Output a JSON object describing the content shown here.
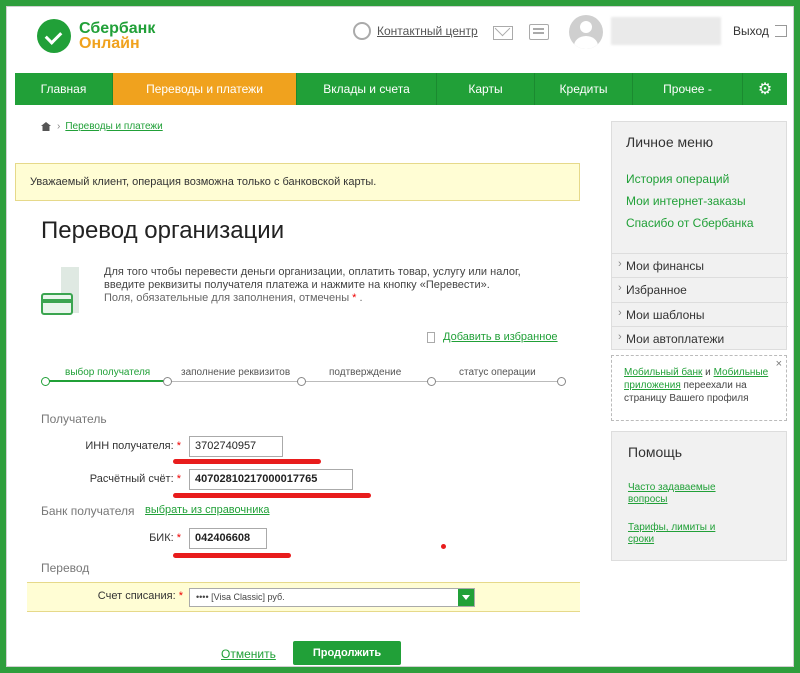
{
  "header": {
    "logo_line1": "Сбербанк",
    "logo_line2": "Онлайн",
    "contact": "Контактный центр",
    "logout": "Выход"
  },
  "nav": {
    "items": [
      "Главная",
      "Переводы и платежи",
      "Вклады и счета",
      "Карты",
      "Кредиты",
      "Прочее -"
    ],
    "active_index": 1,
    "settings_icon": "⚙"
  },
  "breadcrumb": {
    "current": "Переводы и платежи"
  },
  "alert": "Уважаемый клиент, операция возможна только с банковской карты.",
  "page": {
    "title": "Перевод организации",
    "intro": "Для того чтобы перевести деньги организации, оплатить товар, услугу или налог, введите реквизиты получателя платежа и нажмите на кнопку «Перевести».",
    "required_note": "Поля, обязательные для заполнения, отмечены",
    "required_star": "*",
    "required_tail": ".",
    "favorites": "Добавить в избранное"
  },
  "steps": [
    "выбор получателя",
    "заполнение реквизитов",
    "подтверждение",
    "статус операции"
  ],
  "form": {
    "section_recipient": "Получатель",
    "inn_label": "ИНН получателя:",
    "inn_value": "3702740957",
    "account_label": "Расчётный счёт:",
    "account_value": "40702810217000017765",
    "section_bank": "Банк получателя",
    "bank_link": "выбрать из справочника",
    "bik_label": "БИК:",
    "bik_value": "042406608",
    "section_transfer": "Перевод",
    "debit_label": "Счет списания:",
    "debit_value": "•••• [Visa Classic] руб.",
    "star": "*"
  },
  "actions": {
    "cancel": "Отменить",
    "continue": "Продолжить"
  },
  "sidebar": {
    "menu_title": "Личное меню",
    "links": [
      "История операций",
      "Мои интернет-заказы",
      "Спасибо от Сбербанка"
    ],
    "items": [
      "Мои финансы",
      "Избранное",
      "Мои шаблоны",
      "Мои автоплатежи"
    ],
    "note_link1": "Мобильный банк",
    "note_and": " и ",
    "note_link2": "Мобильные приложения",
    "note_rest": " переехали на страницу Вашего профиля",
    "note_close": "×",
    "help_title": "Помощь",
    "help_links": [
      "Часто задаваемые вопросы",
      "Тарифы, лимиты и сроки"
    ]
  },
  "colors": {
    "brand_green": "#21a038",
    "active_tab": "#f0a21e",
    "highlight": "#e81c1c"
  }
}
